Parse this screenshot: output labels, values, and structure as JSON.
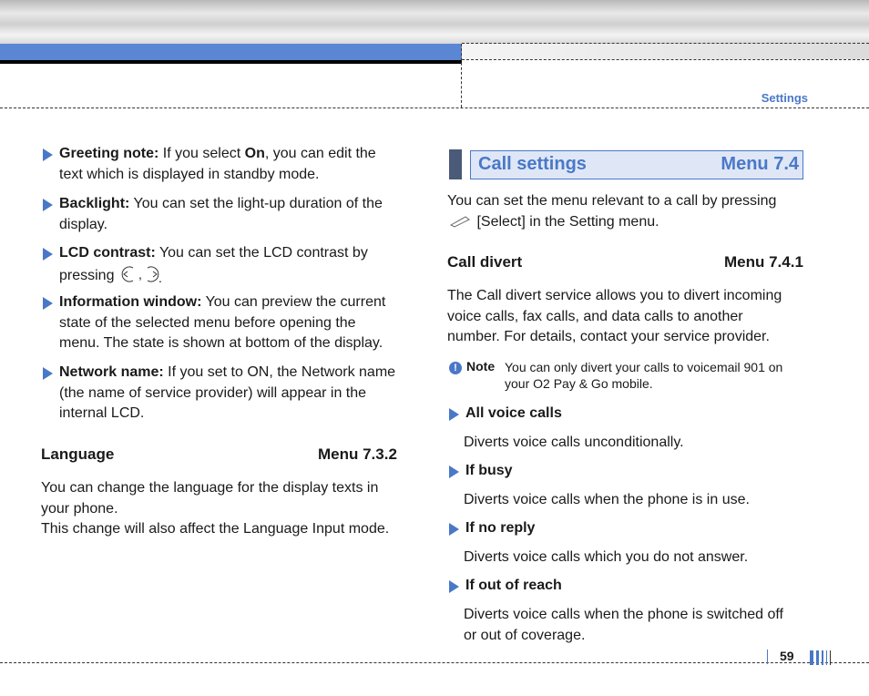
{
  "header": {
    "section_label": "Settings"
  },
  "left": {
    "bullets": [
      {
        "term": "Greeting note:",
        "lines": [
          "If you select <On>, you can edit the",
          "text which is displayed in standby mode."
        ]
      },
      {
        "term": "Backlight:",
        "lines": [
          "You can set the light-up duration of the",
          "display."
        ]
      },
      {
        "term": "LCD contrast:",
        "lines": [
          "You can set the LCD contrast by",
          "pressing"
        ]
      },
      {
        "term": "Information window:",
        "lines": [
          "You can preview the current",
          "state of the selected menu before opening the",
          "menu. The state is shown at bottom of the display."
        ]
      },
      {
        "term": "Network name:",
        "lines": [
          "If you set to ON, the Network name",
          "(the name of service provider) will appear in the",
          "internal LCD."
        ]
      }
    ],
    "greeting_on": "On",
    "greeting_rest": ", you can edit the",
    "greeting_pre": "If you select ",
    "language": {
      "title": "Language",
      "menu": "Menu 7.3.2",
      "lines": [
        "You can change the language for the display texts in",
        "your phone.",
        "This change will also affect the Language Input mode."
      ]
    }
  },
  "right": {
    "call_settings": {
      "title": "Call settings",
      "menu": "Menu 7.4"
    },
    "intro": [
      "You can set the menu relevant to a call by pressing",
      "[Select] in the Setting menu."
    ],
    "call_divert": {
      "title": "Call divert",
      "menu": "Menu 7.4.1",
      "lines": [
        "The Call divert service allows you to divert incoming",
        "voice calls, fax calls, and data calls to another",
        "number. For details, contact your service provider."
      ]
    },
    "note": {
      "label": "Note",
      "lines": [
        "You can only divert your calls to voicemail 901 on",
        "your O2 Pay & Go mobile."
      ]
    },
    "options": [
      {
        "title": "All voice calls",
        "desc": [
          "Diverts voice calls unconditionally."
        ]
      },
      {
        "title": "If busy",
        "desc": [
          "Diverts voice calls when the phone is in use."
        ]
      },
      {
        "title": "If no reply",
        "desc": [
          "Diverts voice calls which you do not answer."
        ]
      },
      {
        "title": "If out of reach",
        "desc": [
          "Diverts voice calls when the phone is switched off",
          "or out of coverage."
        ]
      }
    ]
  },
  "footer": {
    "page_number": "59"
  },
  "colors": {
    "accent": "#4a78c8",
    "header_blue": "#5b86d4"
  },
  "icons": [
    "nav-left-key-icon",
    "nav-right-key-icon",
    "soft-key-icon",
    "info-icon"
  ]
}
